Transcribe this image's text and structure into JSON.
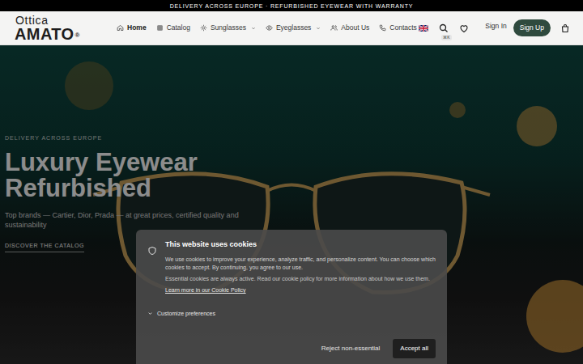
{
  "announcement": "DELIVERY ACROSS EUROPE · REFURBISHED EYEWEAR WITH WARRANTY",
  "logo": {
    "top": "Ottica",
    "main": "AMATO",
    "mark": "®"
  },
  "nav": [
    {
      "label": "Home",
      "selected": true,
      "dropdown": false,
      "kind": "home"
    },
    {
      "label": "Catalog",
      "selected": false,
      "dropdown": false,
      "kind": "catalog"
    },
    {
      "label": "Sunglasses",
      "selected": false,
      "dropdown": true,
      "kind": "sun"
    },
    {
      "label": "Eyeglasses",
      "selected": false,
      "dropdown": true,
      "kind": "eye"
    },
    {
      "label": "About Us",
      "selected": false,
      "dropdown": false,
      "kind": "users"
    },
    {
      "label": "Contacts",
      "selected": false,
      "dropdown": false,
      "kind": "phone"
    }
  ],
  "search_shortcut": "⌘K",
  "account": {
    "sign_in": "Sign In",
    "sign_up": "Sign Up"
  },
  "hero": {
    "eyebrow": "DELIVERY ACROSS EUROPE",
    "title_1": "Luxury Eyewear",
    "title_2": "Refurbished",
    "subtitle": "Top brands — Cartier, Dior, Prada — at great prices, certified quality and sustainability",
    "cta": "DISCOVER THE CATALOG"
  },
  "cookie": {
    "title": "This website uses cookies",
    "body": "We use cookies to improve your experience, analyze traffic, and personalize content. You can choose which cookies to accept. By continuing, you agree to our use.",
    "note": "Essential cookies are always active. Read our cookie policy for more information about how we use them.",
    "link": "Learn more in our Cookie Policy",
    "customize": "Customize preferences",
    "reject": "Reject non-essential",
    "accept": "Accept all"
  }
}
